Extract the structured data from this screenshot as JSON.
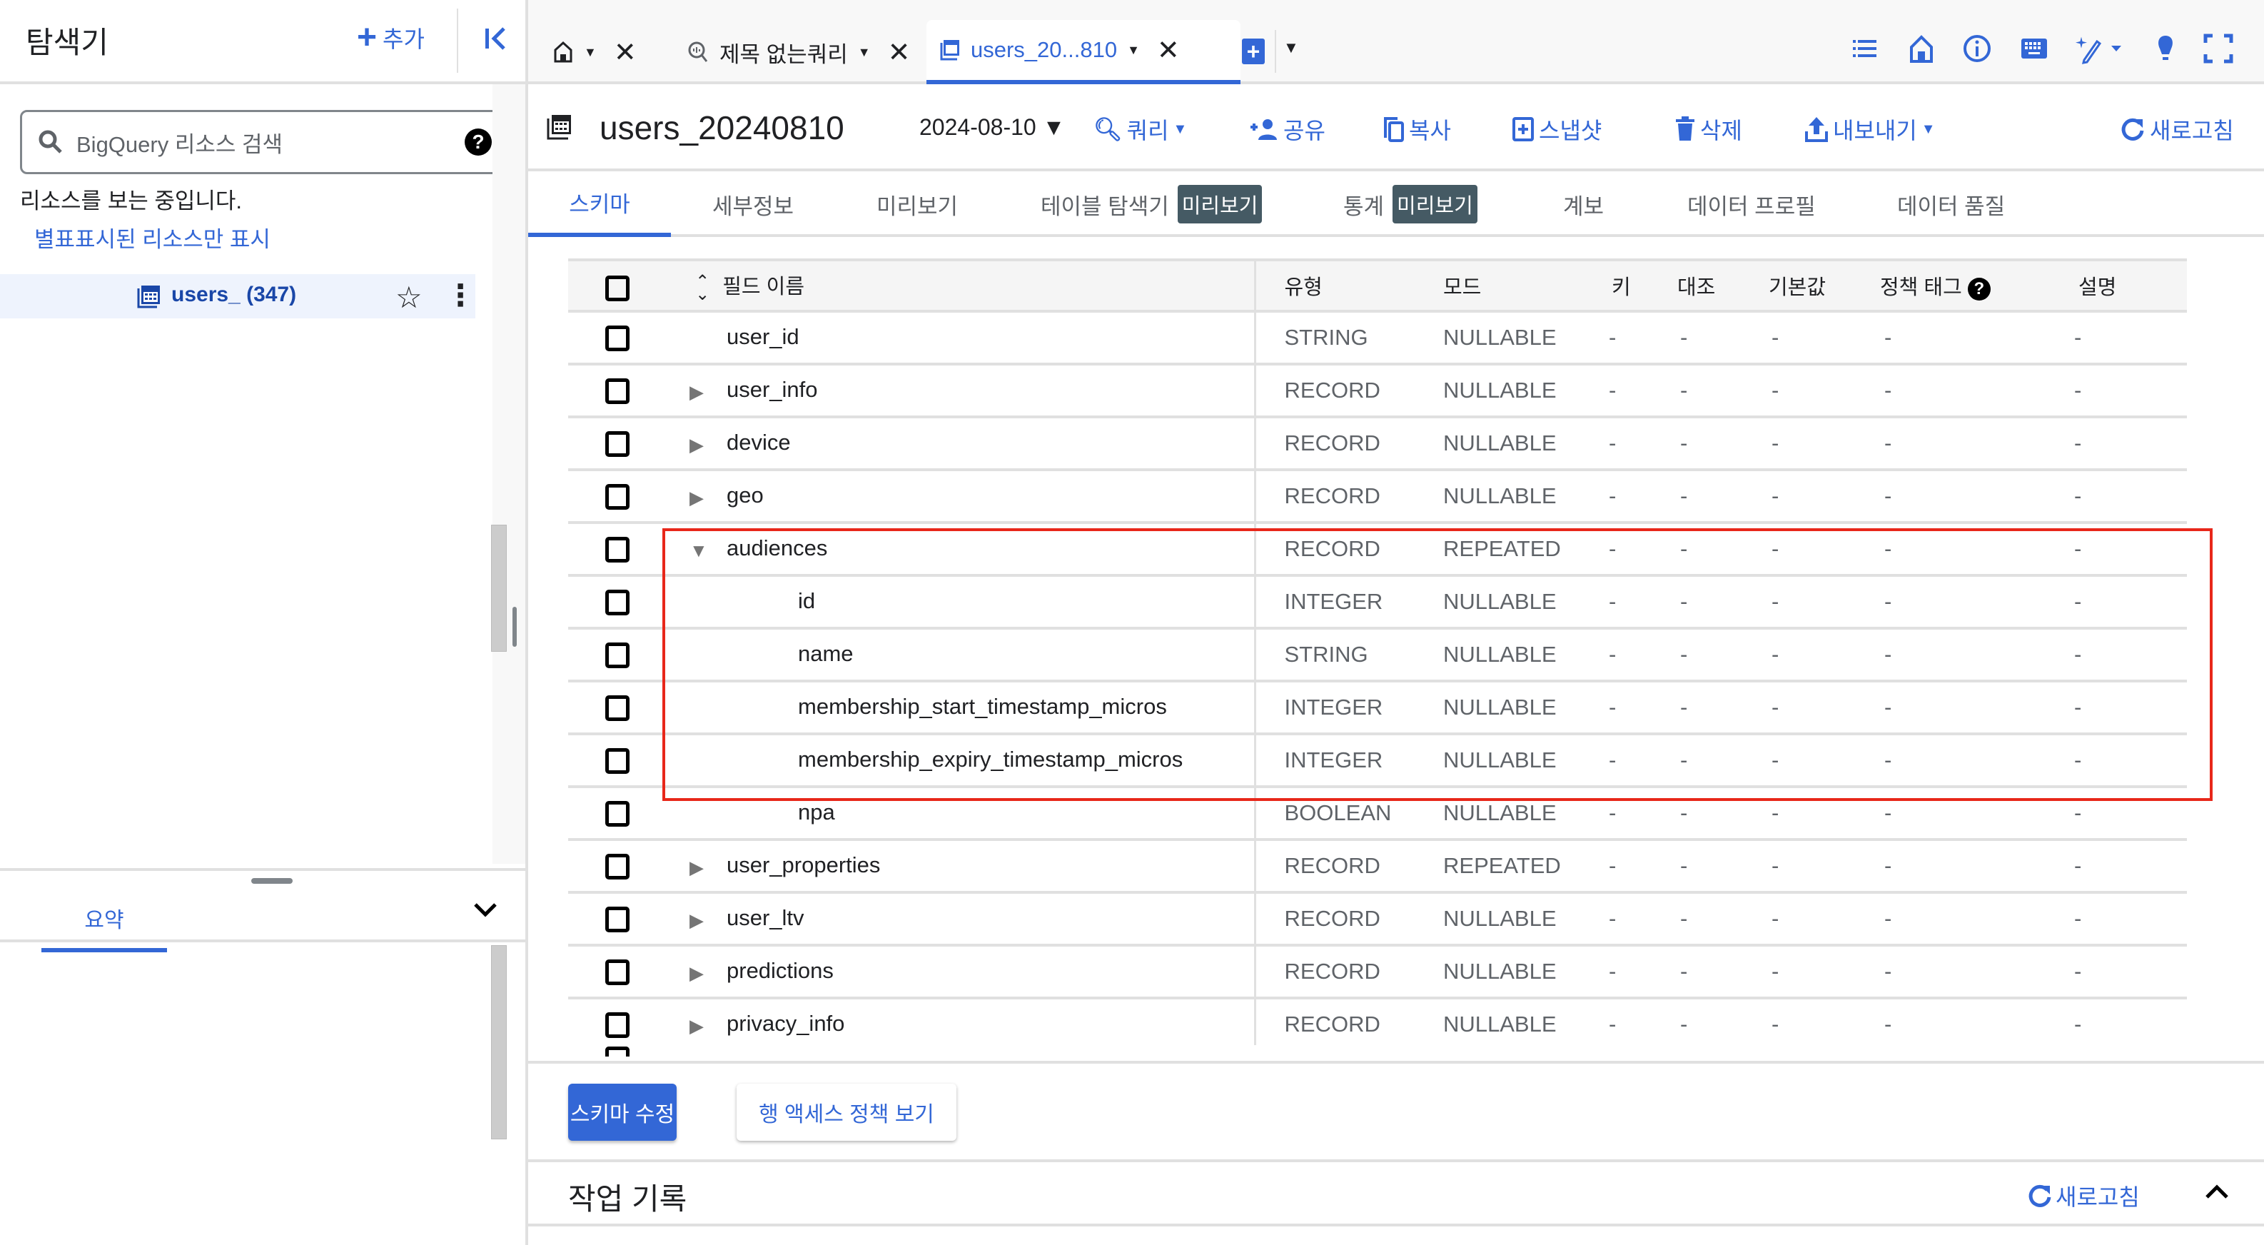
{
  "sidebar": {
    "title": "탐색기",
    "add_label": "추가",
    "search_placeholder": "BigQuery 리소스 검색",
    "viewing_text": "리소스를 보는 중입니다.",
    "starred_only_link": "별표표시된 리소스만 표시",
    "tree_item": {
      "label": "users_ (347)",
      "icon": "table-icon"
    },
    "bottom_tab": "요약"
  },
  "tabs": [
    {
      "label": "",
      "icon": "home-icon"
    },
    {
      "label": "제목 없는쿼리",
      "icon": "query-icon"
    },
    {
      "label": "users_20...810",
      "icon": "table-icon",
      "active": true
    }
  ],
  "top_icons": [
    "list-icon",
    "home-icon",
    "info-icon",
    "keyboard-icon",
    "ai-pencil-icon",
    "lightbulb-icon",
    "fullscreen-icon"
  ],
  "toolbar": {
    "table_name": "users_20240810",
    "date": "2024-08-10",
    "query": "쿼리",
    "share": "공유",
    "copy": "복사",
    "snapshot": "스냅샷",
    "delete": "삭제",
    "export": "내보내기",
    "refresh": "새로고침"
  },
  "subtabs": [
    {
      "label": "스키마",
      "active": true
    },
    {
      "label": "세부정보"
    },
    {
      "label": "미리보기"
    },
    {
      "label": "테이블 탐색기",
      "badge": "미리보기"
    },
    {
      "label": "통계",
      "badge": "미리보기"
    },
    {
      "label": "계보"
    },
    {
      "label": "데이터 프로필"
    },
    {
      "label": "데이터 품질"
    }
  ],
  "schema": {
    "headers": {
      "name": "필드 이름",
      "type": "유형",
      "mode": "모드",
      "key": "키",
      "collation": "대조",
      "default": "기본값",
      "policy": "정책 태그",
      "description": "설명"
    },
    "rows": [
      {
        "name": "user_id",
        "type": "STRING",
        "mode": "NULLABLE",
        "level": 0,
        "expand": "none"
      },
      {
        "name": "user_info",
        "type": "RECORD",
        "mode": "NULLABLE",
        "level": 0,
        "expand": "collapsed"
      },
      {
        "name": "device",
        "type": "RECORD",
        "mode": "NULLABLE",
        "level": 0,
        "expand": "collapsed"
      },
      {
        "name": "geo",
        "type": "RECORD",
        "mode": "NULLABLE",
        "level": 0,
        "expand": "collapsed"
      },
      {
        "name": "audiences",
        "type": "RECORD",
        "mode": "REPEATED",
        "level": 0,
        "expand": "expanded"
      },
      {
        "name": "id",
        "type": "INTEGER",
        "mode": "NULLABLE",
        "level": 1,
        "expand": "none"
      },
      {
        "name": "name",
        "type": "STRING",
        "mode": "NULLABLE",
        "level": 1,
        "expand": "none"
      },
      {
        "name": "membership_start_timestamp_micros",
        "type": "INTEGER",
        "mode": "NULLABLE",
        "level": 1,
        "expand": "none"
      },
      {
        "name": "membership_expiry_timestamp_micros",
        "type": "INTEGER",
        "mode": "NULLABLE",
        "level": 1,
        "expand": "none"
      },
      {
        "name": "npa",
        "type": "BOOLEAN",
        "mode": "NULLABLE",
        "level": 1,
        "expand": "none"
      },
      {
        "name": "user_properties",
        "type": "RECORD",
        "mode": "REPEATED",
        "level": 0,
        "expand": "collapsed"
      },
      {
        "name": "user_ltv",
        "type": "RECORD",
        "mode": "NULLABLE",
        "level": 0,
        "expand": "collapsed"
      },
      {
        "name": "predictions",
        "type": "RECORD",
        "mode": "NULLABLE",
        "level": 0,
        "expand": "collapsed"
      },
      {
        "name": "privacy_info",
        "type": "RECORD",
        "mode": "NULLABLE",
        "level": 0,
        "expand": "collapsed"
      }
    ],
    "empty_value": "-"
  },
  "buttons": {
    "edit_schema": "스키마 수정",
    "row_access": "행 액세스 정책 보기"
  },
  "job_history": {
    "title": "작업 기록",
    "refresh": "새로고침"
  },
  "colors": {
    "accent": "#3367d6",
    "highlight_box": "#e8271a",
    "badge_bg": "#455a64"
  }
}
